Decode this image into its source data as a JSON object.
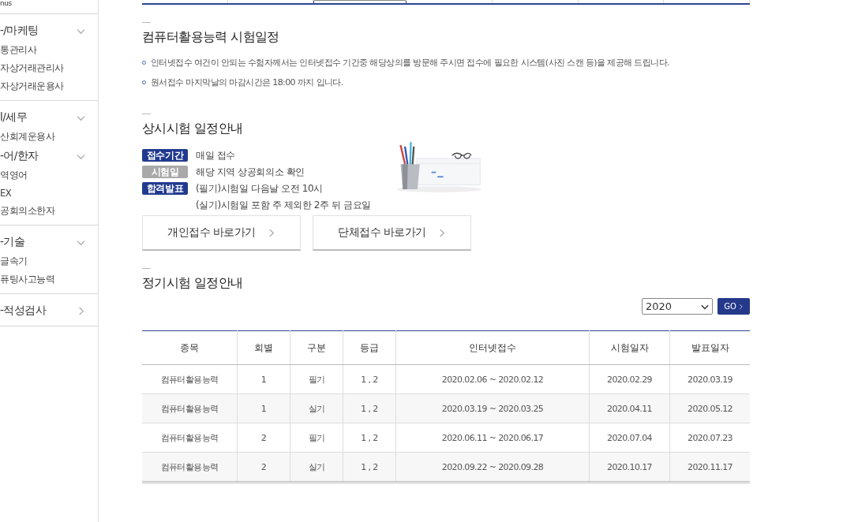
{
  "sidebar": {
    "sections": [
      {
        "groups": [
          {
            "label": "nus"
          }
        ]
      },
      {
        "groups": [
          {
            "label": "-/마케팅",
            "expanded": true,
            "children": [
              "통관리사",
              "자상거래관리사",
              "자상거래운용사"
            ]
          }
        ]
      },
      {
        "groups": [
          {
            "label": "l/세무",
            "expanded": true,
            "children": [
              "산회계운용사"
            ]
          },
          {
            "label": "-어/한자",
            "expanded": true,
            "children": [
              "역영어",
              "EX",
              "공회의소한자"
            ]
          }
        ]
      },
      {
        "groups": [
          {
            "label": "-기술",
            "expanded": true,
            "children": [
              "글속기",
              "퓨팅사고능력"
            ]
          }
        ]
      },
      {
        "groups": [
          {
            "label": "-적성검사",
            "expanded": false
          }
        ]
      }
    ]
  },
  "schedule": {
    "title": "컴퓨터활용능력 시험일정",
    "notes": [
      "인터넷접수 여건이 안되는 수험자께서는 인터넷접수 기간중 해당상의를 방문해 주시면 접수에 필요한 시스템(사진 스캔 등)을 제공해 드립니다.",
      "원서접수 마지막날의 마감시간은 18:00 까지 입니다."
    ]
  },
  "ongoing": {
    "title": "상시시험 일정안내",
    "rows": [
      {
        "badge": "접수기간",
        "color": "#213a8f",
        "text": "매일 접수"
      },
      {
        "badge": "시험일",
        "color": "#a9a9a9",
        "text": "해당 지역 상공회의소 확인"
      },
      {
        "badge": "합격발표",
        "color": "#213a8f",
        "text": "(필기)시험일 다음날 오전 10시"
      },
      {
        "text": "(실기)시험일 포함 주 제외한 2주 뒤 금요일"
      }
    ],
    "buttons": [
      "개인접수 바로가기",
      "단체접수 바로가기"
    ]
  },
  "regular": {
    "title": "정기시험 일정안내",
    "year": "2020",
    "go": "GO",
    "table": {
      "columns": [
        "종목",
        "회별",
        "구분",
        "등급",
        "인터넷접수",
        "시험일자",
        "발표일자"
      ],
      "rows": [
        [
          "컴퓨터활용능력",
          "1",
          "필기",
          "1 , 2",
          "2020.02.06 ~ 2020.02.12",
          "2020.02.29",
          "2020.03.19"
        ],
        [
          "컴퓨터활용능력",
          "1",
          "실기",
          "1 , 2",
          "2020.03.19 ~ 2020.03.25",
          "2020.04.11",
          "2020.05.12"
        ],
        [
          "컴퓨터활용능력",
          "2",
          "필기",
          "1 , 2",
          "2020.06.11 ~ 2020.06.17",
          "2020.07.04",
          "2020.07.23"
        ],
        [
          "컴퓨터활용능력",
          "2",
          "실기",
          "1 , 2",
          "2020.09.22 ~ 2020.09.28",
          "2020.10.17",
          "2020.11.17"
        ]
      ]
    }
  }
}
